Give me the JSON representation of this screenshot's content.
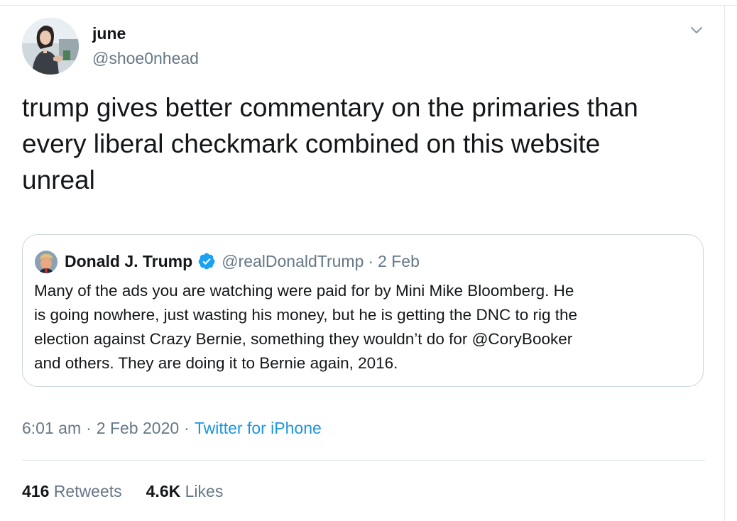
{
  "author": {
    "name": "june",
    "handle": "@shoe0nhead"
  },
  "tweet": {
    "text_lines": [
      "trump gives better commentary on the primaries than",
      "every liberal checkmark combined on this website",
      "unreal"
    ]
  },
  "quoted_tweet": {
    "name": "Donald J. Trump",
    "handle": "@realDonaldTrump",
    "dot": "·",
    "date": "2 Feb",
    "text_lines": [
      "Many of the ads you are watching were paid for by Mini Mike Bloomberg. He",
      "is going nowhere, just wasting his money, but he is getting the DNC to rig the",
      "election against Crazy Bernie, something they wouldn’t do for @CoryBooker",
      "and others. They are doing it to Bernie again, 2016."
    ]
  },
  "meta": {
    "time": "6:01 am",
    "sep1": "·",
    "date": "2 Feb 2020",
    "sep2": "·",
    "source": "Twitter for iPhone"
  },
  "stats": {
    "retweets_count": "416",
    "retweets_label": "Retweets",
    "likes_count": "4.6K",
    "likes_label": "Likes"
  },
  "icons": {
    "more": "chevron-down-icon",
    "verified": "verified-badge-icon"
  },
  "colors": {
    "text": "#14171a",
    "secondary": "#657786",
    "link": "#1b95e0",
    "border": "#ccd6dd"
  }
}
